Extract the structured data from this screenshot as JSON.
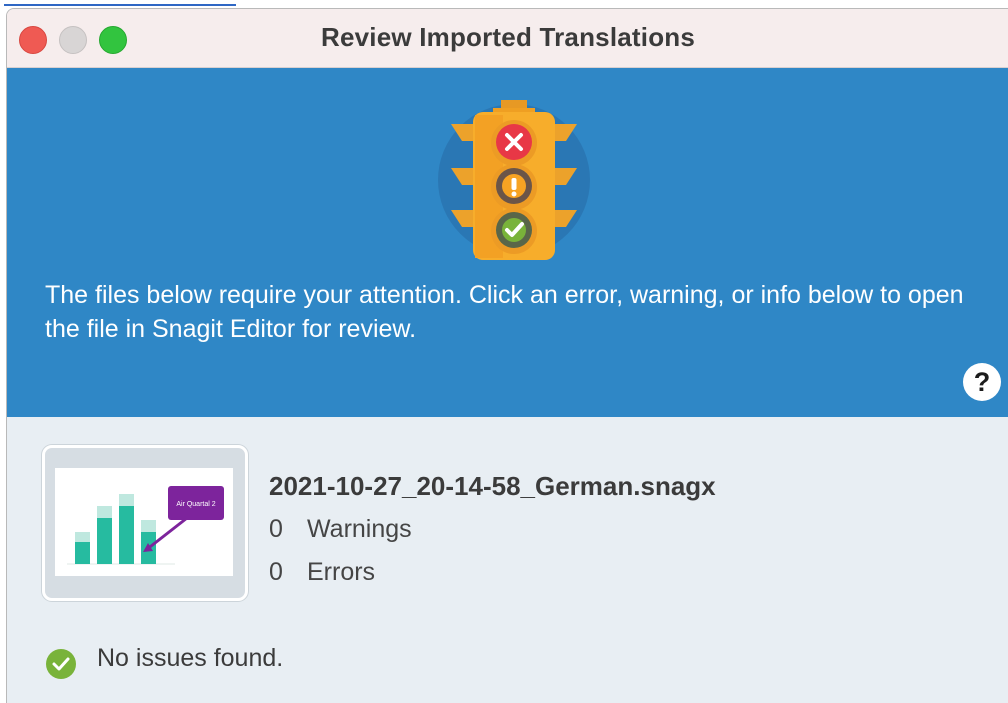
{
  "window": {
    "title": "Review Imported Translations"
  },
  "banner": {
    "message": "The files below require your attention. Click an error, warning, or info below to open the file in Snagit Editor for review.",
    "help_label": "?"
  },
  "file": {
    "name": "2021-10-27_20-14-58_German.snagx",
    "warnings_count": "0",
    "warnings_label": "Warnings",
    "errors_count": "0",
    "errors_label": "Errors",
    "thumbnail_callout": "Air Quartal 2"
  },
  "status": {
    "text": "No issues found.",
    "icon": "check-circle-icon"
  },
  "colors": {
    "banner": "#2f87c6",
    "content": "#e8eef3",
    "success": "#79b33a",
    "error": "#de3a46",
    "warning": "#f0a21d"
  }
}
